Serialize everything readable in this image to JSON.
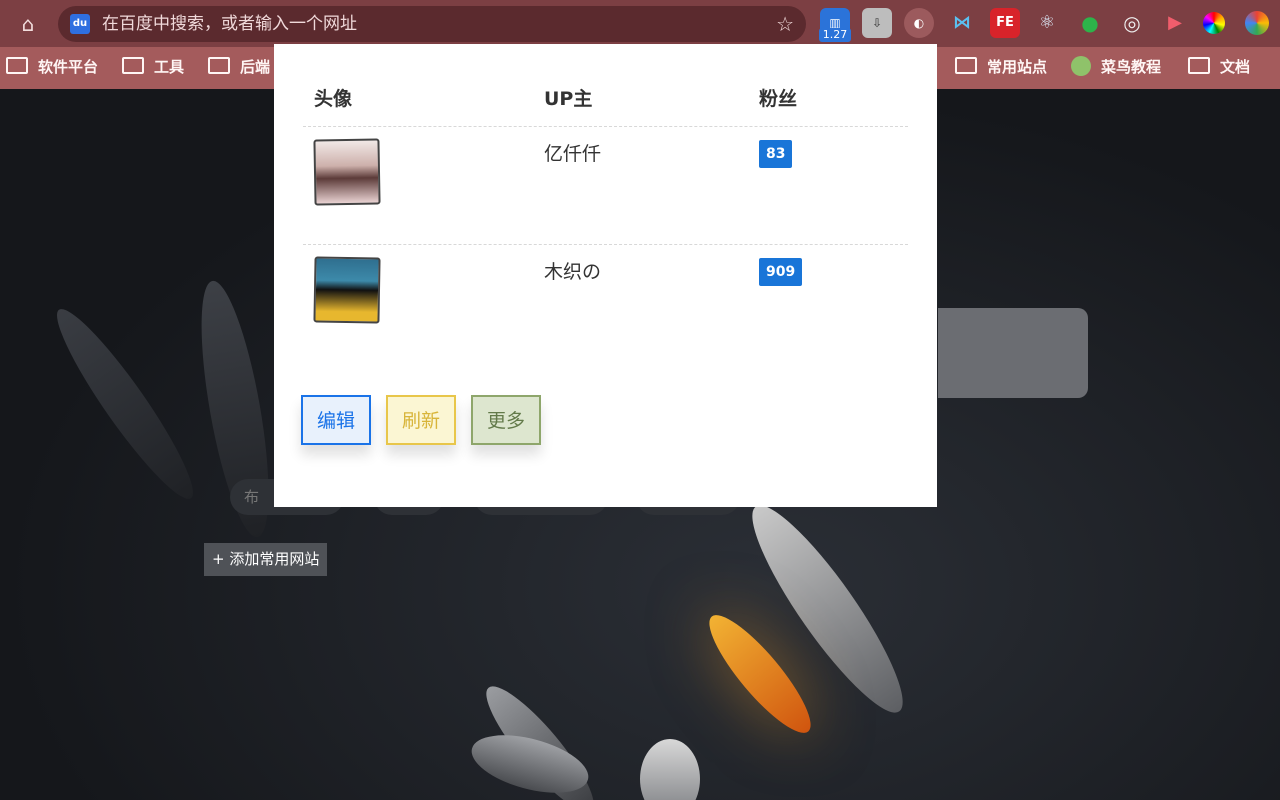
{
  "toolbar": {
    "omnibox_placeholder": "在百度中搜索，或者输入一个网址",
    "engine_icon": "baidu-icon",
    "extension_badge": "1.27",
    "extensions": [
      "stats-extension-icon",
      "download-extension-icon",
      "pie-extension-icon",
      "butterfly-extension-icon",
      "fe-extension-icon",
      "react-extension-icon",
      "evernote-extension-icon",
      "target-extension-icon",
      "video-extension-icon",
      "color-wheel-extension-icon",
      "chrome-circle-extension-icon"
    ],
    "fe_label": "FE"
  },
  "bookmarks": {
    "items": [
      {
        "label": "软件平台"
      },
      {
        "label": "工具"
      },
      {
        "label": "后端"
      },
      {
        "label": "常用站点"
      },
      {
        "label": "菜鸟教程"
      },
      {
        "label": "文档"
      }
    ]
  },
  "newtab": {
    "pill_first_label": "布",
    "add_site_label": "+ 添加常用网站"
  },
  "popup": {
    "headers": {
      "avatar": "头像",
      "up": "UP主",
      "fans": "粉丝"
    },
    "rows": [
      {
        "name": "亿仟仟",
        "fans": "83"
      },
      {
        "name": "木织の",
        "fans": "909"
      }
    ],
    "buttons": {
      "edit": "编辑",
      "refresh": "刷新",
      "more": "更多"
    },
    "colors": {
      "fans_badge": "#1975d8",
      "edit": "#1a73e8",
      "refresh": "#e8c64a",
      "more": "#8ea66b"
    }
  }
}
